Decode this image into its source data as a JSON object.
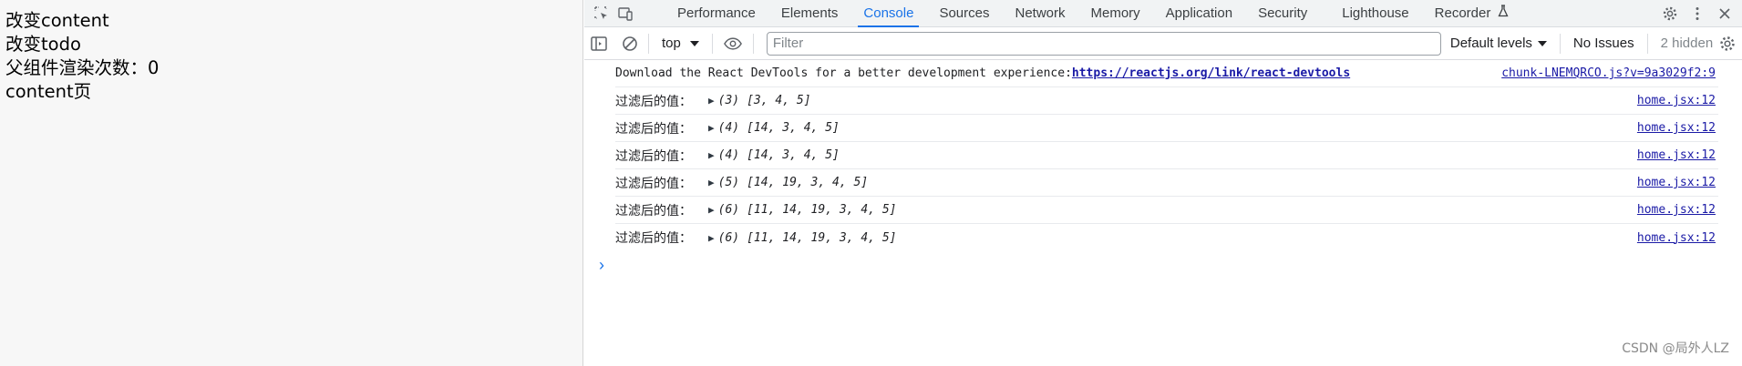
{
  "page": {
    "lines": [
      "改变content",
      "改变todo",
      "父组件渲染次数：0",
      "content页"
    ]
  },
  "devtools": {
    "tabs": [
      "Performance",
      "Elements",
      "Console",
      "Sources",
      "Network",
      "Memory",
      "Application",
      "Security",
      "Lighthouse",
      "Recorder"
    ],
    "active_tab": "Console",
    "toolbar": {
      "context": "top",
      "filter_placeholder": "Filter",
      "levels": "Default levels",
      "issues": "No Issues",
      "hidden": "2 hidden"
    },
    "intro_message": {
      "text": "Download the React DevTools for a better development experience: ",
      "link": "https://reactjs.org/link/react-devtools",
      "source": "chunk-LNEMQRCO.js?v=9a3029f2:9"
    },
    "logs": [
      {
        "label": "过滤后的值：",
        "count": "(3)",
        "array": "[3, 4, 5]",
        "source": "home.jsx:12"
      },
      {
        "label": "过滤后的值：",
        "count": "(4)",
        "array": "[14, 3, 4, 5]",
        "source": "home.jsx:12"
      },
      {
        "label": "过滤后的值：",
        "count": "(4)",
        "array": "[14, 3, 4, 5]",
        "source": "home.jsx:12"
      },
      {
        "label": "过滤后的值：",
        "count": "(5)",
        "array": "[14, 19, 3, 4, 5]",
        "source": "home.jsx:12"
      },
      {
        "label": "过滤后的值：",
        "count": "(6)",
        "array": "[11, 14, 19, 3, 4, 5]",
        "source": "home.jsx:12"
      },
      {
        "label": "过滤后的值：",
        "count": "(6)",
        "array": "[11, 14, 19, 3, 4, 5]",
        "source": "home.jsx:12"
      }
    ],
    "prompt_symbol": "›"
  },
  "watermark": "CSDN @局外人LZ",
  "colors": {
    "accent": "#1a73e8",
    "link": "#1a1aa6"
  }
}
